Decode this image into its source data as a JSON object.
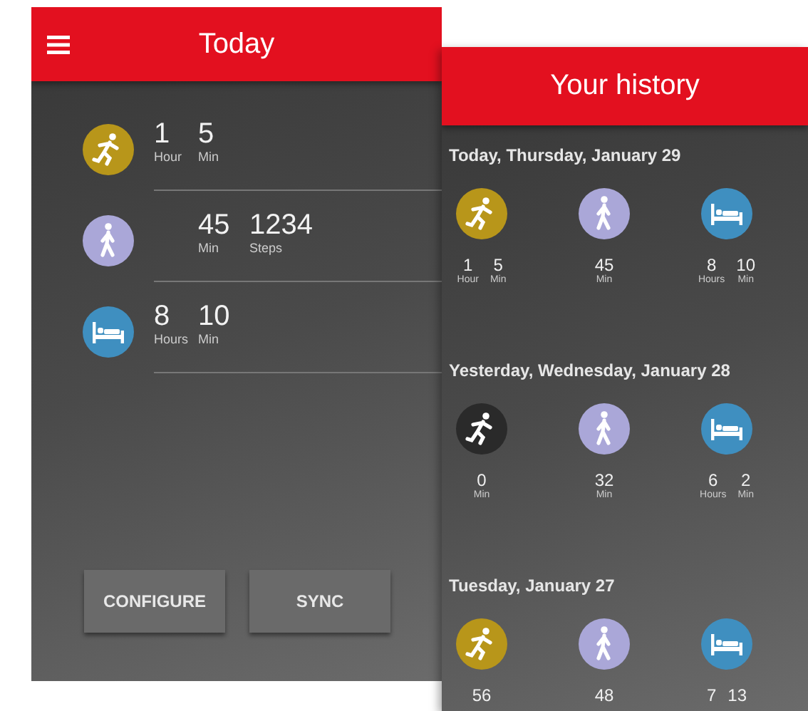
{
  "today_screen": {
    "title": "Today",
    "activities": [
      {
        "kind": "run",
        "color": "#b8961a",
        "values": [
          {
            "value": "1",
            "unit": "Hour"
          },
          {
            "value": "5",
            "unit": "Min"
          }
        ]
      },
      {
        "kind": "walk",
        "color": "#aaa7d8",
        "values": [
          {
            "value": "45",
            "unit": "Min"
          },
          {
            "value": "1234",
            "unit": "Steps"
          }
        ]
      },
      {
        "kind": "sleep",
        "color": "#3f8fc0",
        "values": [
          {
            "value": "8",
            "unit": "Hours"
          },
          {
            "value": "10",
            "unit": "Min"
          }
        ]
      }
    ],
    "buttons": [
      "CONFIGURE",
      "SYNC"
    ]
  },
  "history_screen": {
    "title": "Your history",
    "days": [
      {
        "heading": "Today, Thursday, January 29",
        "activities": [
          {
            "kind": "run",
            "color": "#b8961a",
            "values": [
              {
                "value": "1",
                "unit": "Hour"
              },
              {
                "value": "5",
                "unit": "Min"
              }
            ]
          },
          {
            "kind": "walk",
            "color": "#aaa7d8",
            "values": [
              {
                "value": "45",
                "unit": "Min"
              }
            ]
          },
          {
            "kind": "sleep",
            "color": "#3f8fc0",
            "values": [
              {
                "value": "8",
                "unit": "Hours"
              },
              {
                "value": "10",
                "unit": "Min"
              }
            ]
          }
        ]
      },
      {
        "heading": "Yesterday, Wednesday, January 28",
        "activities": [
          {
            "kind": "run",
            "color": "#2a2a2a",
            "values": [
              {
                "value": "0",
                "unit": "Min"
              }
            ]
          },
          {
            "kind": "walk",
            "color": "#aaa7d8",
            "values": [
              {
                "value": "32",
                "unit": "Min"
              }
            ]
          },
          {
            "kind": "sleep",
            "color": "#3f8fc0",
            "values": [
              {
                "value": "6",
                "unit": "Hours"
              },
              {
                "value": "2",
                "unit": "Min"
              }
            ]
          }
        ]
      },
      {
        "heading": "Tuesday, January 27",
        "activities": [
          {
            "kind": "run",
            "color": "#b8961a",
            "values": [
              {
                "value": "56"
              }
            ]
          },
          {
            "kind": "walk",
            "color": "#aaa7d8",
            "values": [
              {
                "value": "48"
              }
            ]
          },
          {
            "kind": "sleep",
            "color": "#3f8fc0",
            "values": [
              {
                "value": "7"
              },
              {
                "value": "13"
              }
            ]
          }
        ]
      }
    ]
  }
}
